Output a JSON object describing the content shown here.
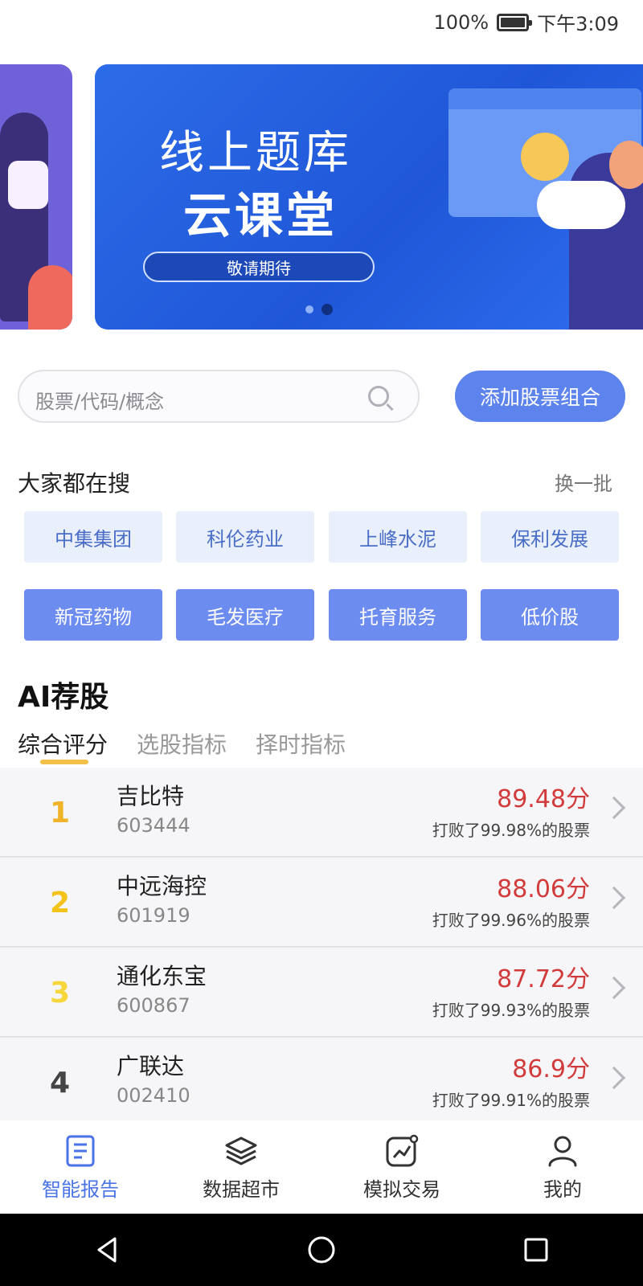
{
  "status_bar": {
    "battery": "100%",
    "time": "下午3:09"
  },
  "banner": {
    "title_line1": "线上题库",
    "title_line2": "云课堂",
    "pill_text": "敬请期待",
    "page_count": 2,
    "active_page": 2
  },
  "search": {
    "placeholder": "股票/代码/概念",
    "add_button": "添加股票组合"
  },
  "hot": {
    "title": "大家都在搜",
    "refresh": "换一批",
    "tags": [
      {
        "label": "中集集团",
        "style": "light"
      },
      {
        "label": "科伦药业",
        "style": "light"
      },
      {
        "label": "上峰水泥",
        "style": "light"
      },
      {
        "label": "保利发展",
        "style": "light"
      },
      {
        "label": "新冠药物",
        "style": "solid"
      },
      {
        "label": "毛发医疗",
        "style": "solid"
      },
      {
        "label": "托育服务",
        "style": "solid"
      },
      {
        "label": "低价股",
        "style": "solid"
      }
    ]
  },
  "ai": {
    "title": "AI荐股",
    "tabs": [
      "综合评分",
      "选股指标",
      "择时指标"
    ],
    "active_tab": 0,
    "stocks": [
      {
        "rank": "1",
        "name": "吉比特",
        "code": "603444",
        "score": "89.48分",
        "beat": "打败了99.98%的股票",
        "rank_color": "#f0b429"
      },
      {
        "rank": "2",
        "name": "中远海控",
        "code": "601919",
        "score": "88.06分",
        "beat": "打败了99.96%的股票",
        "rank_color": "#f3c21b"
      },
      {
        "rank": "3",
        "name": "通化东宝",
        "code": "600867",
        "score": "87.72分",
        "beat": "打败了99.93%的股票",
        "rank_color": "#f6d63a"
      },
      {
        "rank": "4",
        "name": "广联达",
        "code": "002410",
        "score": "86.9分",
        "beat": "打败了99.91%的股票",
        "rank_color": "#444444"
      }
    ]
  },
  "bottom_nav": [
    {
      "label": "智能报告",
      "icon": "report-icon",
      "active": true
    },
    {
      "label": "数据超市",
      "icon": "layers-icon",
      "active": false
    },
    {
      "label": "模拟交易",
      "icon": "trade-chart-icon",
      "active": false
    },
    {
      "label": "我的",
      "icon": "user-icon",
      "active": false
    }
  ],
  "colors": {
    "accent": "#5d83ec",
    "score_red": "#d23b3b",
    "tab_underline": "#f3c14a"
  }
}
